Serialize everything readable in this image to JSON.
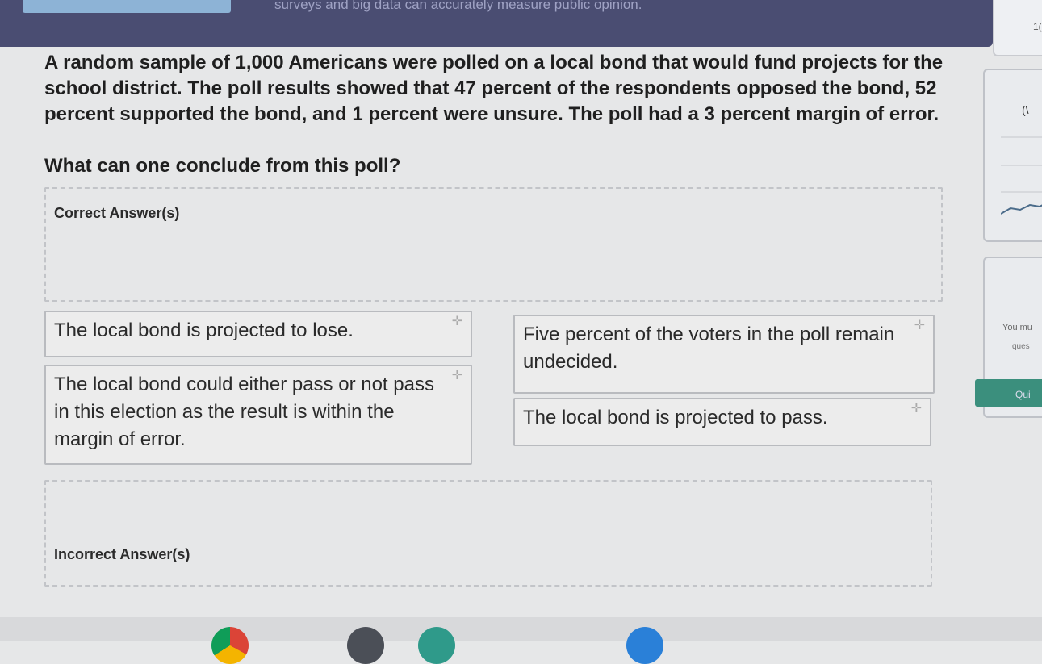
{
  "header": {
    "subtitle": "surveys and big data can accurately measure public opinion."
  },
  "question": {
    "text": "A random sample of 1,000 Americans were polled on a local bond that would fund projects for the school district. The poll results showed that 47 percent of the respondents opposed the bond, 52 percent supported the bond, and 1 percent were unsure. The poll had a 3 percent margin of error.",
    "prompt": "What can one conclude from this poll?"
  },
  "zones": {
    "correct_label": "Correct Answer(s)",
    "incorrect_label": "Incorrect Answer(s)"
  },
  "tiles": [
    {
      "text": "The local bond is projected to lose."
    },
    {
      "text": "Five percent of the voters in the poll remain undecided."
    },
    {
      "text": "The local bond could either pass or not pass in this election as the result is within the margin of error."
    },
    {
      "text": "The local bond is projected to pass."
    }
  ],
  "side_panel": {
    "top_text": "1(",
    "glyph": "(\\",
    "hint_line1": "You mu",
    "hint_line2": "ques",
    "quiz_button": "Qui"
  },
  "colors": {
    "header_bg": "#4a4d72",
    "tab_chip": "#8db3d6",
    "quiz_button": "#3b8f7d"
  }
}
